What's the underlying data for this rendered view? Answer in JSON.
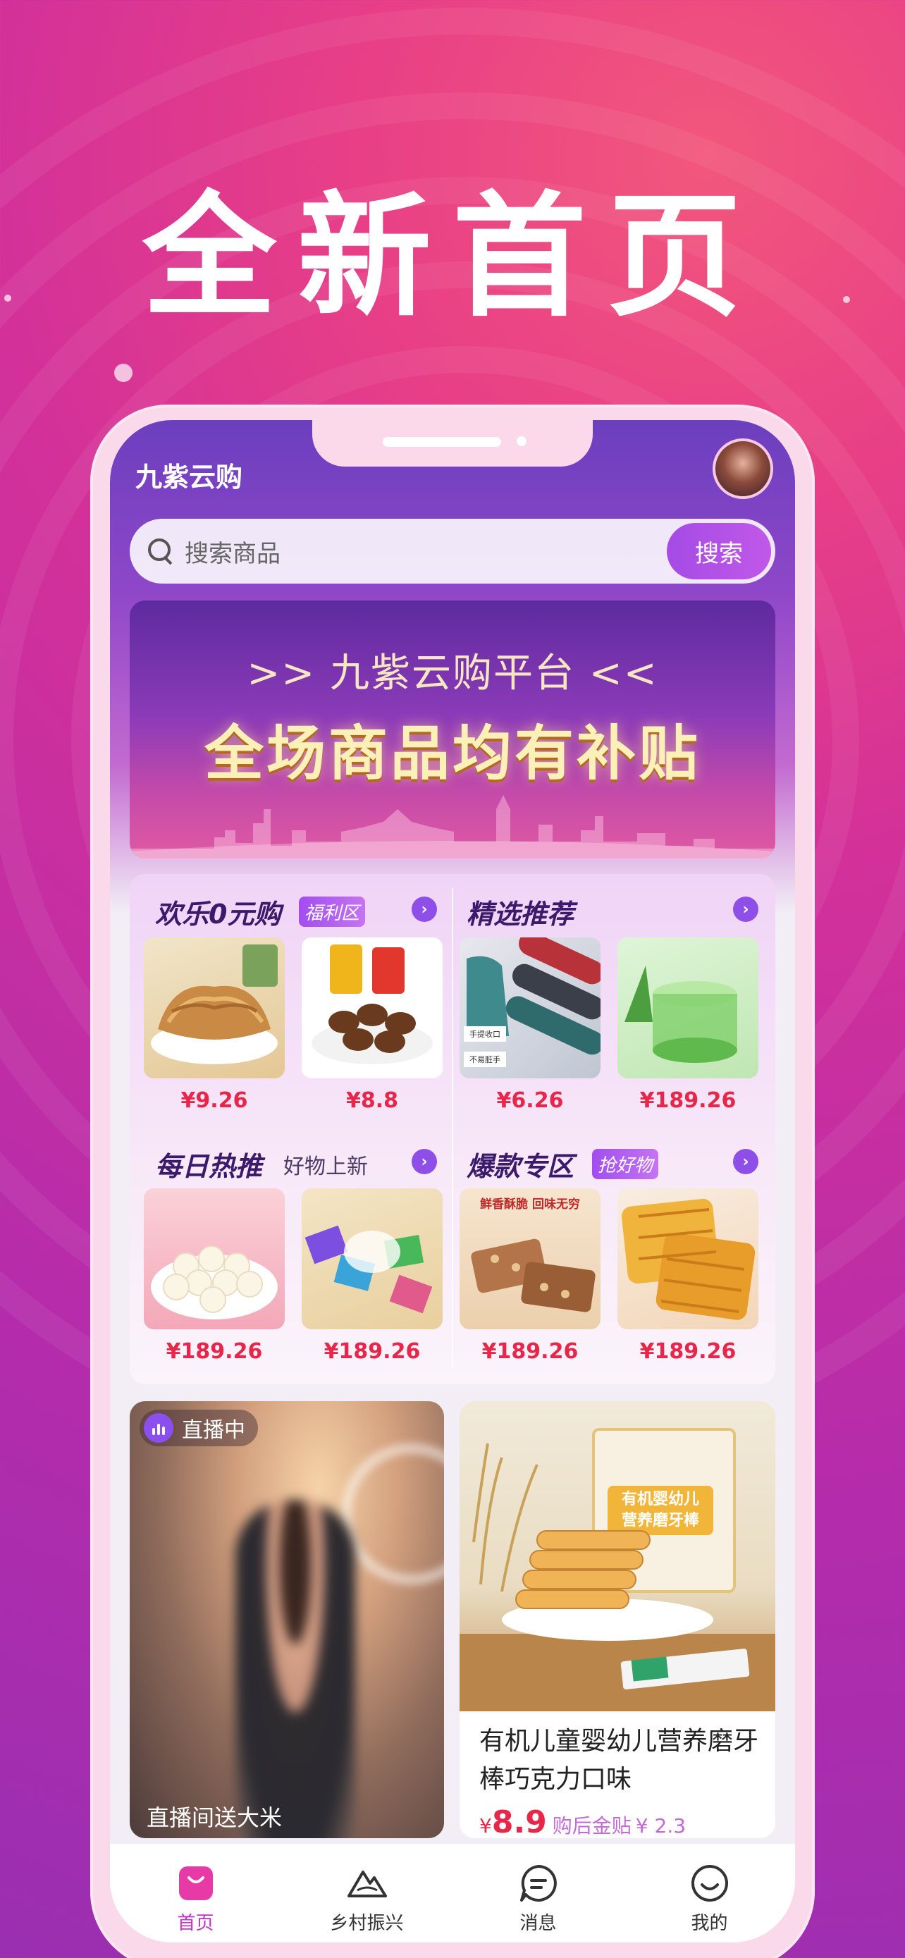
{
  "headline": "全新首页",
  "app": {
    "title": "九紫云购"
  },
  "search": {
    "placeholder": "搜索商品",
    "button_label": "搜索"
  },
  "banner": {
    "subtitle": ">> 九紫云购平台 <<",
    "title": "全场商品均有补贴"
  },
  "sections": [
    {
      "title": "欢乐0元购",
      "tag": "福利区",
      "products": [
        {
          "name": "noodle-snack",
          "price": "¥9.26"
        },
        {
          "name": "broad-beans",
          "price": "¥8.8"
        }
      ]
    },
    {
      "title": "精选推荐",
      "tag": "",
      "products": [
        {
          "name": "trash-bags",
          "price": "¥6.26",
          "img_text_1": "手提收口",
          "img_text_2": "不易脏手"
        },
        {
          "name": "aloe-gel",
          "price": "¥189.26"
        }
      ]
    },
    {
      "title": "每日热推",
      "tag": "好物上新",
      "products": [
        {
          "name": "milk-candy",
          "price": "¥189.26"
        },
        {
          "name": "candy-pack",
          "price": "¥189.26"
        }
      ]
    },
    {
      "title": "爆款专区",
      "tag": "抢好物",
      "products": [
        {
          "name": "nut-bar",
          "price": "¥189.26",
          "img_text_1": "鲜香酥脆 回味无穷"
        },
        {
          "name": "waffle",
          "price": "¥189.26"
        }
      ]
    }
  ],
  "live": {
    "badge": "直播中",
    "caption": "直播间送大米"
  },
  "goods": {
    "title": "有机儿童婴幼儿营养磨牙棒巧克力口味",
    "currency": "¥",
    "price": "8.9",
    "subsidy_label": "购后金贴",
    "subsidy_value": "¥ 2.3",
    "box_text": "有机婴幼儿营养磨牙棒"
  },
  "tabbar": [
    {
      "label": "首页",
      "icon": "shopping-bag-icon",
      "active": true
    },
    {
      "label": "乡村振兴",
      "icon": "mountain-icon",
      "active": false
    },
    {
      "label": "消息",
      "icon": "message-icon",
      "active": false
    },
    {
      "label": "我的",
      "icon": "smile-icon",
      "active": false
    }
  ],
  "colors": {
    "accent": "#8d4fe8",
    "price": "#e8264a",
    "active_tab": "#c033c9"
  }
}
